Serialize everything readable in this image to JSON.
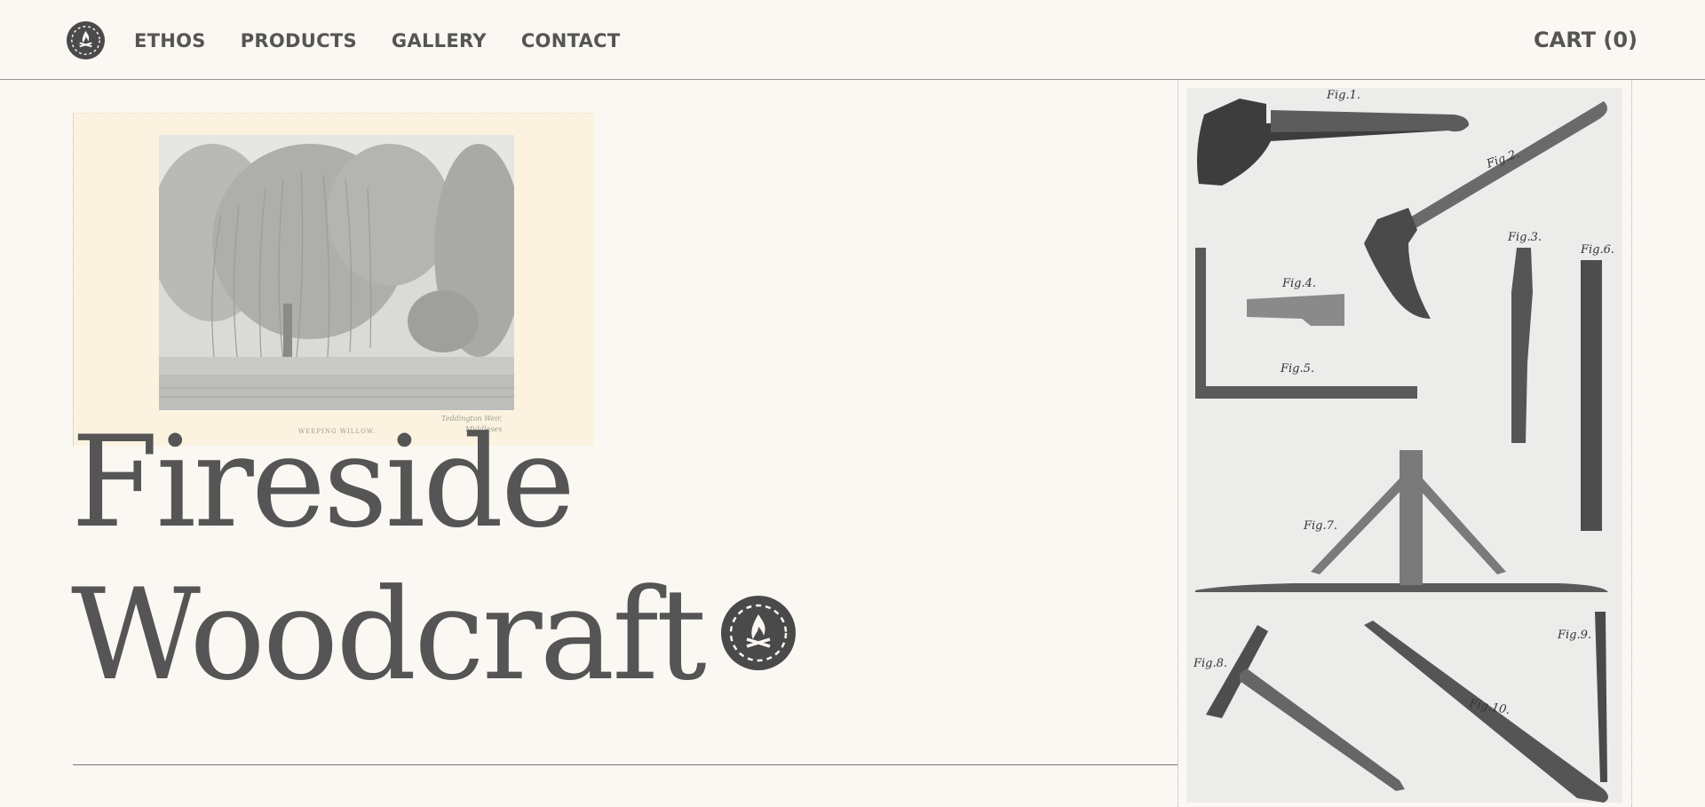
{
  "nav": {
    "items": [
      {
        "label": "ETHOS"
      },
      {
        "label": "PRODUCTS"
      },
      {
        "label": "GALLERY"
      },
      {
        "label": "CONTACT"
      }
    ],
    "cart_label": "CART (0)"
  },
  "hero": {
    "title_line1": "Fireside",
    "title_line2": "Woodcraft",
    "photo_caption": "WEEPING WILLOW.",
    "photo_location_line1": "Teddington Weir,",
    "photo_location_line2": "Middlesex"
  },
  "plate": {
    "figures": [
      "Fig.1.",
      "Fig.2.",
      "Fig.3.",
      "Fig.4.",
      "Fig.5.",
      "Fig.6.",
      "Fig.7.",
      "Fig.8.",
      "Fig.9.",
      "Fig.10."
    ]
  },
  "colors": {
    "background": "#fbf8f3",
    "text": "#555555",
    "logo": "#4a4a4a"
  },
  "icons": {
    "logo": "campfire-badge-icon",
    "title_badge": "campfire-badge-icon"
  }
}
